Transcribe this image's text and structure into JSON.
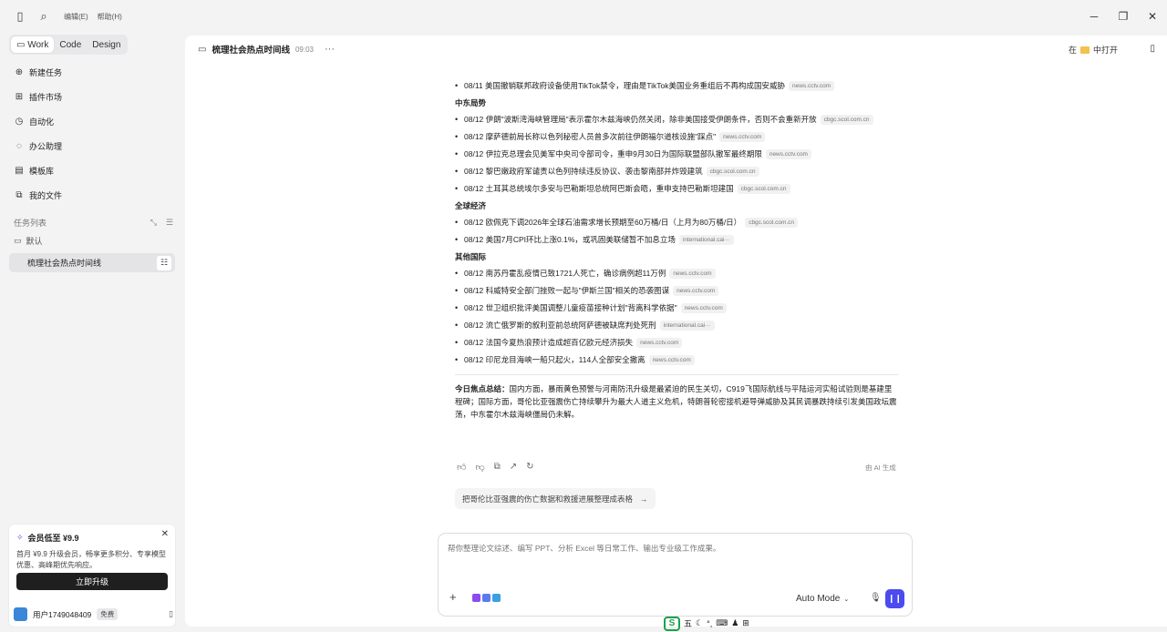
{
  "titlebar": {
    "menu": [
      "编辑(E)",
      "帮助(H)"
    ]
  },
  "sidebar": {
    "modes": [
      "Work",
      "Code",
      "Design"
    ],
    "nav": [
      "新建任务",
      "插件市场",
      "自动化",
      "办公助理",
      "模板库",
      "我的文件"
    ],
    "task_list_title": "任务列表",
    "folder": "默认",
    "active_task": "梳理社会热点时间线",
    "promo": {
      "title": "会员低至 ¥9.9",
      "text": "首月 ¥9.9 升级会员，畅享更多积分、专享模型优惠、高峰期优先响应。",
      "button": "立即升级"
    },
    "user": {
      "name": "用户1749048409",
      "badge": "免费"
    }
  },
  "main": {
    "title": "梳理社会热点时间线",
    "time": "09:03",
    "open_in_prefix": "在",
    "open_in_suffix": "中打开",
    "sections": [
      {
        "title": "",
        "items": [
          {
            "text": "08/11 美国撤销联邦政府设备使用TikTok禁令，理由是TikTok美国业务重组后不再构成国安威胁",
            "src": "news.cctv.com"
          }
        ]
      },
      {
        "title": "中东局势",
        "items": [
          {
            "text": "08/12 伊朗\"波斯湾海峡管理局\"表示霍尔木兹海峡仍然关闭，除非美国接受伊朗条件，否则不会重新开放",
            "src": "cbgc.scol.com.cn"
          },
          {
            "text": "08/12 摩萨德前局长称以色列秘密人员曾多次前往伊朗福尔道核设施\"踩点\"",
            "src": "news.cctv.com"
          },
          {
            "text": "08/12 伊拉克总理会见美军中央司令部司令，重申9月30日为国际联盟部队撤军最终期限",
            "src": "news.cctv.com"
          },
          {
            "text": "08/12 黎巴嫩政府军谴责以色列持续违反协议、袭击黎南部并炸毁建筑",
            "src": "cbgc.scol.com.cn"
          },
          {
            "text": "08/12 土耳其总统埃尔多安与巴勒斯坦总统阿巴斯会晤，重申支持巴勒斯坦建国",
            "src": "cbgc.scol.com.cn"
          }
        ]
      },
      {
        "title": "全球经济",
        "items": [
          {
            "text": "08/12 欧佩克下调2026年全球石油需求增长预期至60万桶/日（上月为80万桶/日）",
            "src": "cbgc.scol.com.cn"
          },
          {
            "text": "08/12 美国7月CPI环比上涨0.1%，或巩固美联储暂不加息立场",
            "src": "international.cai···"
          }
        ]
      },
      {
        "title": "其他国际",
        "items": [
          {
            "text": "08/12 南苏丹霍乱疫情已致1721人死亡，确诊病例超11万例",
            "src": "news.cctv.com"
          },
          {
            "text": "08/12 科威特安全部门挫败一起与\"伊斯兰国\"相关的恐袭图谋",
            "src": "news.cctv.com"
          },
          {
            "text": "08/12 世卫组织批评美国调整儿童疫苗接种计划\"背离科学依据\"",
            "src": "news.cctv.com"
          },
          {
            "text": "08/12 流亡俄罗斯的叙利亚前总统阿萨德被缺席判处死刑",
            "src": "international.cai···"
          },
          {
            "text": "08/12 法国今夏热浪预计造成超百亿欧元经济损失",
            "src": "news.cctv.com"
          },
          {
            "text": "08/12 印尼龙目海峡一船只起火，114人全部安全撤离",
            "src": "news.cctv.com"
          }
        ]
      }
    ],
    "summary_label": "今日焦点总结：",
    "summary_text": "国内方面，暴雨黄色预警与河南防汛升级是最紧迫的民生关切，C919飞国际航线与平陆运河实船试验则是基建里程碑；国际方面，哥伦比亚强震伤亡持续攀升为最大人道主义危机，特朗普轮密接机避导弹威胁及其民调暴跌持续引发美国政坛震荡，中东霍尔木兹海峡僵局仍未解。",
    "ai_generated": "由 AI 生成",
    "suggestion": "把哥伦比亚强震的伤亡数据和救援进展整理成表格"
  },
  "composer": {
    "placeholder": "帮你整理论文综述、编写 PPT、分析 Excel 等日常工作、输出专业级工作成果。",
    "mode": "Auto Mode"
  },
  "ime": {
    "mode": "五"
  },
  "colors": {
    "accent": "#4b4bf0",
    "folder": "#f2c14e",
    "ime_green": "#1aa34a"
  }
}
